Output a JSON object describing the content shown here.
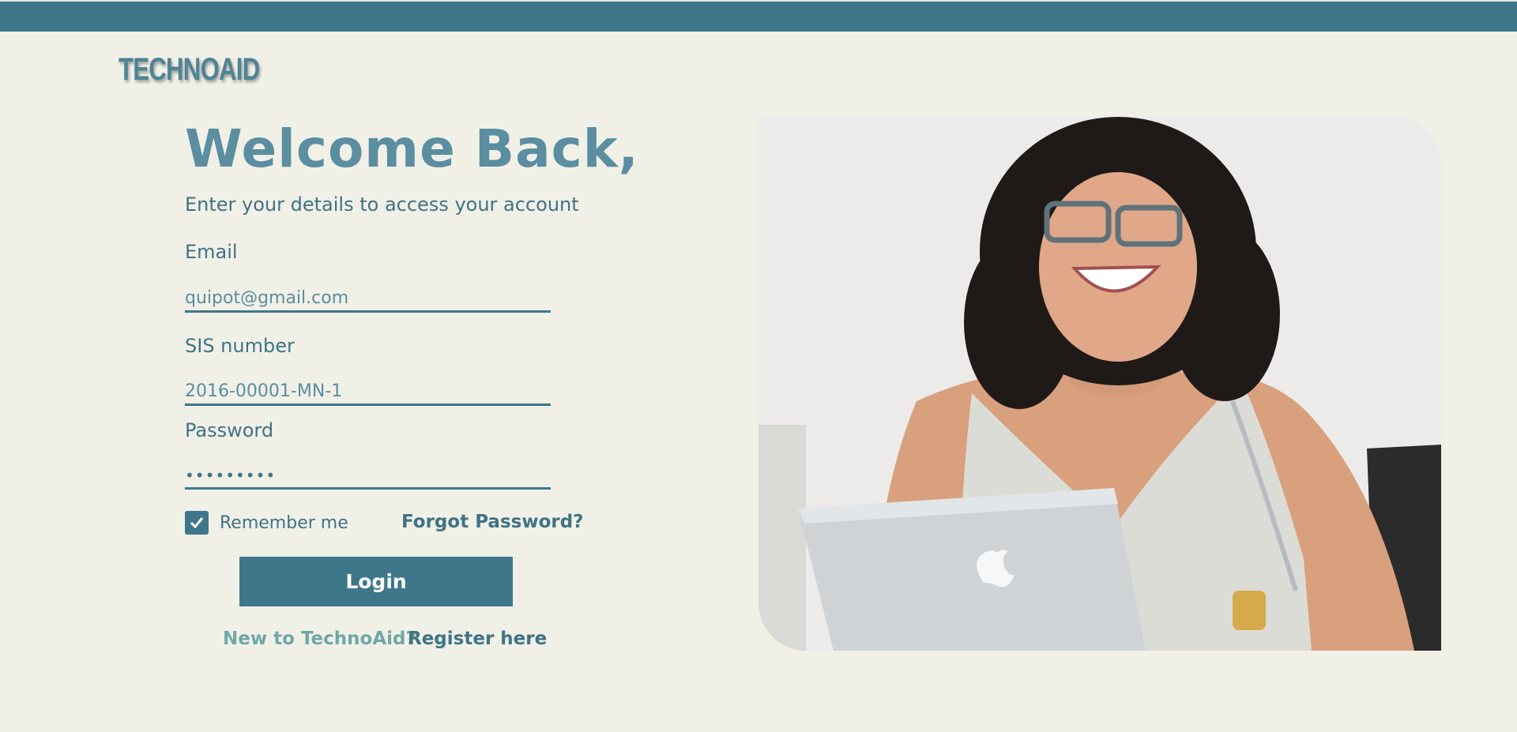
{
  "brand": {
    "logo": "TECHNOAID"
  },
  "header": {
    "title": "Welcome Back,",
    "subtitle": "Enter your details to access your account"
  },
  "form": {
    "email_label": "Email",
    "email_value": "quipot@gmail.com",
    "sis_label": "SIS number",
    "sis_value": "2016-00001-MN-1",
    "password_label": "Password",
    "password_value": "•••••••••",
    "remember_label": "Remember me",
    "remember_checked": true,
    "forgot_link": "Forgot Password?",
    "login_button": "Login",
    "new_prompt": "New to TechnoAid?",
    "register_link": "Register here"
  },
  "colors": {
    "primary": "#3f778a",
    "background": "#f1f0e7",
    "accent_green": "#6fa8a5"
  }
}
